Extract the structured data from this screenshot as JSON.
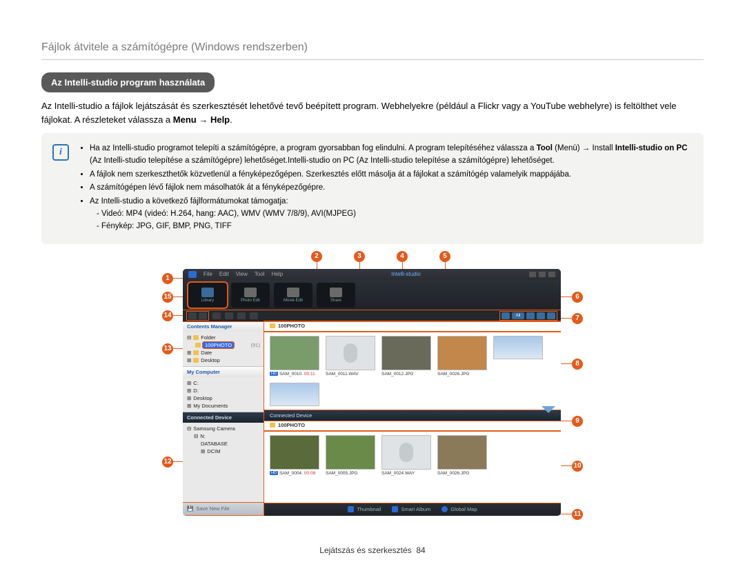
{
  "page_title": "Fájlok átvitele a számítógépre (Windows rendszerben)",
  "section_title": "Az Intelli-studio program használata",
  "intro_text": "Az Intelli-studio a fájlok lejátszását és szerkesztését lehetővé tevő beépített program. Webhelyekre (például a Flickr vagy a YouTube webhelyre) is feltölthet vele fájlokat. A részleteket válassza a Menu → Help.",
  "notes": {
    "b1_a": "Ha az Intelli-studio programot telepíti a számítógépre, a program gyorsabban fog elindulni. A program telepítéséhez válassza a ",
    "b1_tool": "Tool",
    "b1_b": " (Menü) → Install ",
    "b1_is": "Intelli-studio on PC",
    "b1_c": " (Az Intelli-studio telepítése a számítógépre) lehetőséget.Intelli-studio on PC (Az Intelli-studio telepítése a számítógépre) lehetőséget.",
    "b2": "A fájlok nem szerkeszthetők közvetlenül a fényképezőgépen. Szerkesztés előtt másolja át a fájlokat a számítógép valamelyik mappájába.",
    "b3": "A számítógépen lévő fájlok nem másolhatók át a fényképezőgépre.",
    "b4": "Az Intelli-studio a következő fájlformátumokat támogatja:",
    "b4_video": "- Videó: MP4 (videó: H.264, hang: AAC), WMV (WMV 7/8/9), AVI(MJPEG)",
    "b4_photo": "- Fénykép: JPG, GIF, BMP, PNG, TIFF"
  },
  "callouts": [
    "1",
    "2",
    "3",
    "4",
    "5",
    "6",
    "7",
    "8",
    "9",
    "10",
    "11",
    "12",
    "13",
    "14",
    "15"
  ],
  "app": {
    "menu": [
      "File",
      "Edit",
      "View",
      "Tool",
      "Help"
    ],
    "logo": "Intelli-studio",
    "modes": [
      "Library",
      "Photo Edit",
      "Movie Edit",
      "Share"
    ],
    "tb_all": "All",
    "side": {
      "contents_mgr": "Contents Manager",
      "folder": "Folder",
      "hl_folder": "100PHOTO",
      "hl_count": "(91)",
      "date": "Date",
      "desktop": "Desktop",
      "my_computer": "My Computer",
      "c": "C:",
      "d": "D:",
      "desk": "Desktop",
      "docs": "My Documents",
      "connected_device": "Connected Device",
      "camera": "Samsung Camera",
      "drive": "N:",
      "database": "DATABASE",
      "dcim": "DCIM",
      "save_new": "Save New File"
    },
    "crumb": "100PHOTO",
    "crumb2": "100PHOTO",
    "thumbs_top": [
      {
        "name": "SAM_0010.",
        "meta": "00:11",
        "hd": true
      },
      {
        "name": "SAM_0011.WAV"
      },
      {
        "name": "SAM_0012.JPG"
      },
      {
        "name": "SAM_0026.JPG"
      }
    ],
    "thumbs_bottom": [
      {
        "name": "SAM_0004.",
        "meta": "00:08",
        "hd": true
      },
      {
        "name": "SAM_0005.JPG"
      },
      {
        "name": "SAM_0024.WAY"
      },
      {
        "name": "SAM_0026.JPG"
      }
    ],
    "tabs": [
      "Thumbnail",
      "Smart Album",
      "Global Map"
    ]
  },
  "footer": {
    "label": "Lejátszás és szerkesztés",
    "page": "84"
  }
}
